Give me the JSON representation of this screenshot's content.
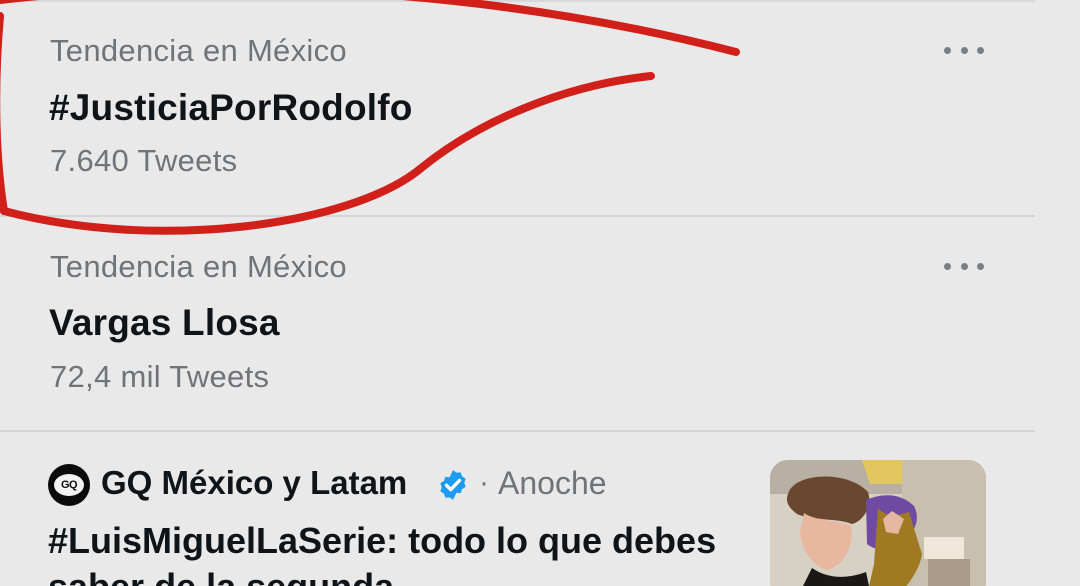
{
  "trends": [
    {
      "context": "Tendencia en México",
      "title": "#JusticiaPorRodolfo",
      "count": "7.640 Tweets"
    },
    {
      "context": "Tendencia en México",
      "title": "Vargas Llosa",
      "count": "72,4 mil Tweets"
    }
  ],
  "news": {
    "source": "GQ México y Latam",
    "separator": "·",
    "time": "Anoche",
    "headline": "#LuisMiguelLaSerie: todo lo que debes saber de la segunda",
    "avatar_text": "GQ",
    "verified": true
  },
  "icons": {
    "more": "more-horizontal-icon",
    "verified": "verified-badge-icon"
  },
  "colors": {
    "background": "#e9e9ea",
    "primary_text": "#0f1419",
    "secondary_text": "#6f7479",
    "verified_blue": "#1d9bf0",
    "annotation_red": "#d11f1a"
  }
}
